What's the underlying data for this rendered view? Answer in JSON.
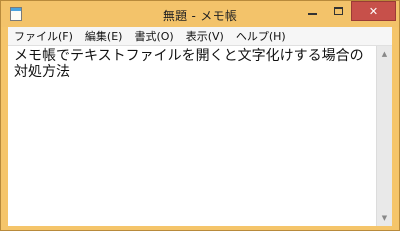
{
  "window": {
    "title": "無題 - メモ帳"
  },
  "menu": {
    "items": [
      {
        "label": "ファイル(F)"
      },
      {
        "label": "編集(E)"
      },
      {
        "label": "書式(O)"
      },
      {
        "label": "表示(V)"
      },
      {
        "label": "ヘルプ(H)"
      }
    ]
  },
  "editor": {
    "text": "メモ帳でテキストファイルを開くと文字化けする場合の対処方法"
  },
  "icons": {
    "app": "notepad-icon",
    "minimize": "minimize-icon",
    "maximize": "maximize-icon",
    "close": "close-icon"
  },
  "colors": {
    "titlebar": "#f3c36a",
    "close_button": "#c7504a"
  }
}
